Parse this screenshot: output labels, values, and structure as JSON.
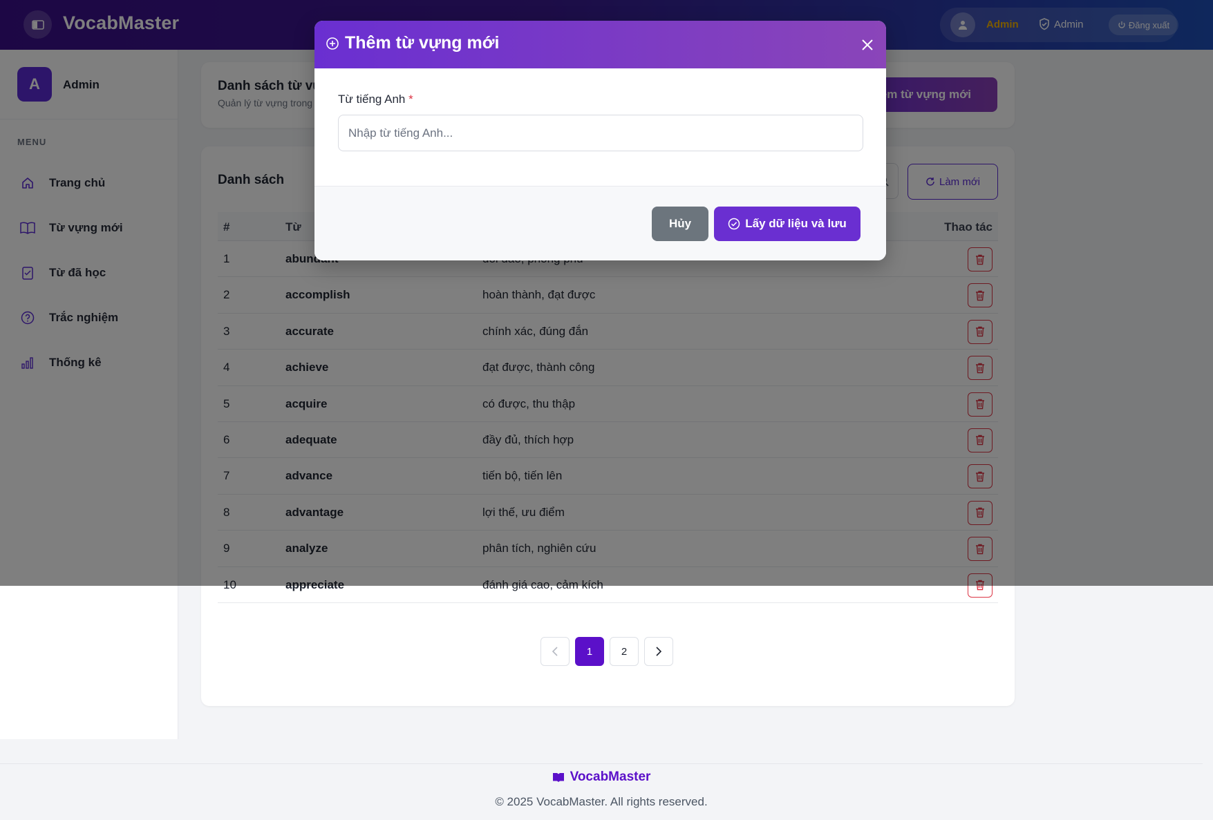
{
  "app": {
    "brand": "VocabMaster",
    "accent_color": "#5b2bd4",
    "menu_toggle_icon": "sidebar-toggle-icon"
  },
  "header": {
    "user_name": "Admin",
    "role_label": "Admin",
    "logout_label": "Đăng xuất"
  },
  "sidebar": {
    "profile_initial": "A",
    "profile_name": "Admin",
    "menu_heading": "MENU",
    "items": [
      {
        "label": "Trang chủ",
        "icon": "home-icon"
      },
      {
        "label": "Từ vựng mới",
        "icon": "book-icon"
      },
      {
        "label": "Từ đã học",
        "icon": "checklist-icon"
      },
      {
        "label": "Trắc nghiệm",
        "icon": "question-icon"
      },
      {
        "label": "Thống kê",
        "icon": "bar-chart-icon"
      }
    ]
  },
  "page": {
    "title": "Danh sách từ vựng",
    "subtitle": "Quản lý từ vựng trong hệ thống",
    "add_button": "Thêm từ vựng mới"
  },
  "list": {
    "title": "Danh sách",
    "refresh_label": "Làm mới",
    "columns": [
      "#",
      "Từ",
      "Thao tác"
    ],
    "rows": [
      {
        "idx": "1",
        "word": "abundant",
        "meaning": "dồi dào, phong phú"
      },
      {
        "idx": "2",
        "word": "accomplish",
        "meaning": "hoàn thành, đạt được"
      },
      {
        "idx": "3",
        "word": "accurate",
        "meaning": "chính xác, đúng đắn"
      },
      {
        "idx": "4",
        "word": "achieve",
        "meaning": "đạt được, thành công"
      },
      {
        "idx": "5",
        "word": "acquire",
        "meaning": "có được, thu thập"
      },
      {
        "idx": "6",
        "word": "adequate",
        "meaning": "đầy đủ, thích hợp"
      },
      {
        "idx": "7",
        "word": "advance",
        "meaning": "tiến bộ, tiến lên"
      },
      {
        "idx": "8",
        "word": "advantage",
        "meaning": "lợi thế, ưu điểm"
      },
      {
        "idx": "9",
        "word": "analyze",
        "meaning": "phân tích, nghiên cứu"
      },
      {
        "idx": "10",
        "word": "appreciate",
        "meaning": "đánh giá cao, cảm kích"
      }
    ],
    "pagination": {
      "pages": [
        "1",
        "2"
      ],
      "current": "1"
    }
  },
  "modal": {
    "title": "Thêm từ vựng mới",
    "field_label": "Từ tiếng Anh",
    "required_mark": "*",
    "input_placeholder": "Nhập từ tiếng Anh...",
    "input_value": "",
    "cancel_label": "Hủy",
    "save_label": "Lấy dữ liệu và lưu"
  },
  "footer": {
    "brand": "VocabMaster",
    "copyright": "© 2025 VocabMaster. All rights reserved."
  }
}
